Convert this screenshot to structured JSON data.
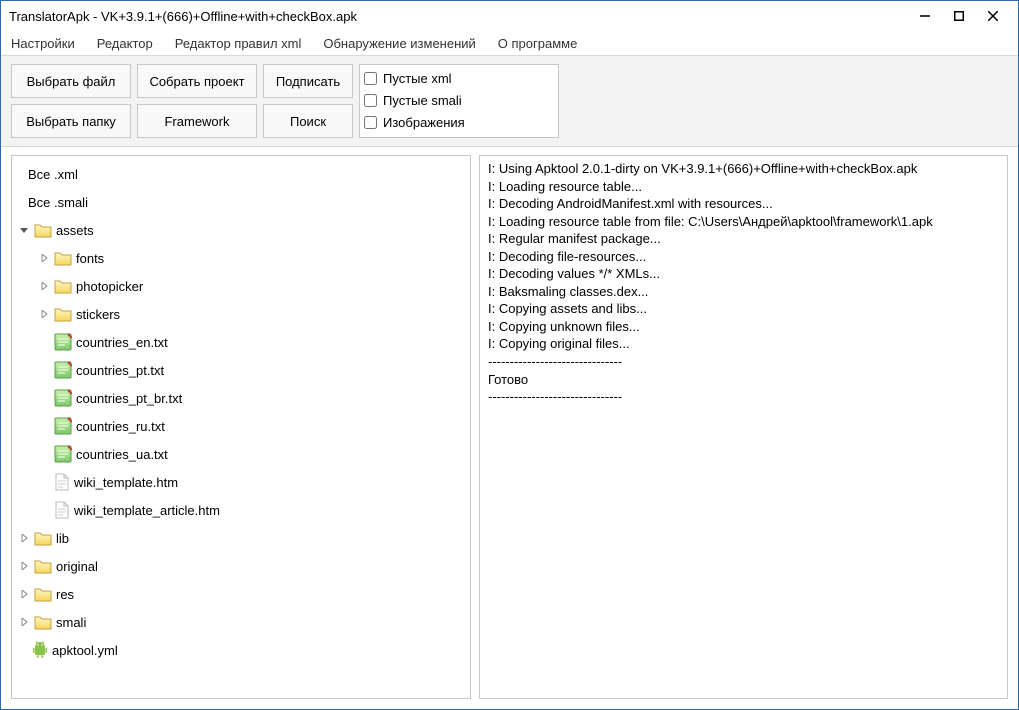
{
  "window": {
    "title": "TranslatorApk - VK+3.9.1+(666)+Offline+with+checkBox.apk"
  },
  "menu": {
    "settings": "Настройки",
    "editor": "Редактор",
    "xml_rules_editor": "Редактор правил xml",
    "change_detection": "Обнаружение изменений",
    "about": "О программе"
  },
  "toolbar": {
    "select_file": "Выбрать файл",
    "select_folder": "Выбрать папку",
    "build_project": "Собрать проект",
    "framework": "Framework",
    "sign": "Подписать",
    "search": "Поиск"
  },
  "filters": {
    "empty_xml": "Пустые xml",
    "empty_smali": "Пустые smali",
    "images": "Изображения"
  },
  "tree": {
    "all_xml": "Все .xml",
    "all_smali": "Все .smali",
    "assets": "assets",
    "fonts": "fonts",
    "photopicker": "photopicker",
    "stickers": "stickers",
    "countries_en": "countries_en.txt",
    "countries_pt": "countries_pt.txt",
    "countries_pt_br": "countries_pt_br.txt",
    "countries_ru": "countries_ru.txt",
    "countries_ua": "countries_ua.txt",
    "wiki_template": "wiki_template.htm",
    "wiki_template_article": "wiki_template_article.htm",
    "lib": "lib",
    "original": "original",
    "res": "res",
    "smali": "smali",
    "apktool_yml": "apktool.yml"
  },
  "log": {
    "l1": "I: Using Apktool 2.0.1-dirty on VK+3.9.1+(666)+Offline+with+checkBox.apk",
    "l2": "I: Loading resource table...",
    "l3": "I: Decoding AndroidManifest.xml with resources...",
    "l4": "I: Loading resource table from file: C:\\Users\\Андрей\\apktool\\framework\\1.apk",
    "l5": "I: Regular manifest package...",
    "l6": "I: Decoding file-resources...",
    "l7": "I: Decoding values */* XMLs...",
    "l8": "I: Baksmaling classes.dex...",
    "l9": "I: Copying assets and libs...",
    "l10": "I: Copying unknown files...",
    "l11": "I: Copying original files...",
    "sep1": "-------------------------------",
    "done": "Готово",
    "sep2": "-------------------------------"
  }
}
